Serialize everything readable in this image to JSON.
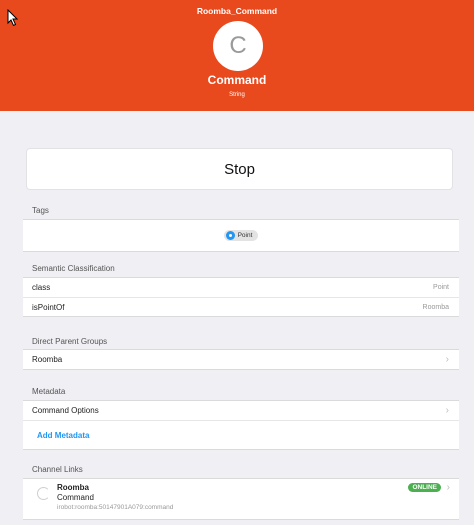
{
  "header": {
    "title": "Roomba_Command",
    "avatar_letter": "C",
    "name": "Command",
    "type": "String",
    "background": "#e8491d"
  },
  "command_button": {
    "label": "Stop"
  },
  "tags": {
    "label": "Tags",
    "items": [
      {
        "label": "Point",
        "icon": "point-dot-icon"
      }
    ]
  },
  "semantic": {
    "label": "Semantic Classification",
    "rows": [
      {
        "key": "class",
        "value": "Point"
      },
      {
        "key": "isPointOf",
        "value": "Roomba"
      }
    ]
  },
  "parent_groups": {
    "label": "Direct Parent Groups",
    "items": [
      {
        "label": "Roomba"
      }
    ]
  },
  "metadata": {
    "label": "Metadata",
    "items": [
      {
        "label": "Command Options"
      }
    ],
    "add_label": "Add Metadata"
  },
  "channel_links": {
    "label": "Channel Links",
    "items": [
      {
        "title": "Roomba",
        "subtitle": "Command",
        "uid": "irobot:roomba:50147901A079:command",
        "status": "ONLINE",
        "status_color": "#4caf50"
      }
    ]
  },
  "accent": "#2196f3"
}
